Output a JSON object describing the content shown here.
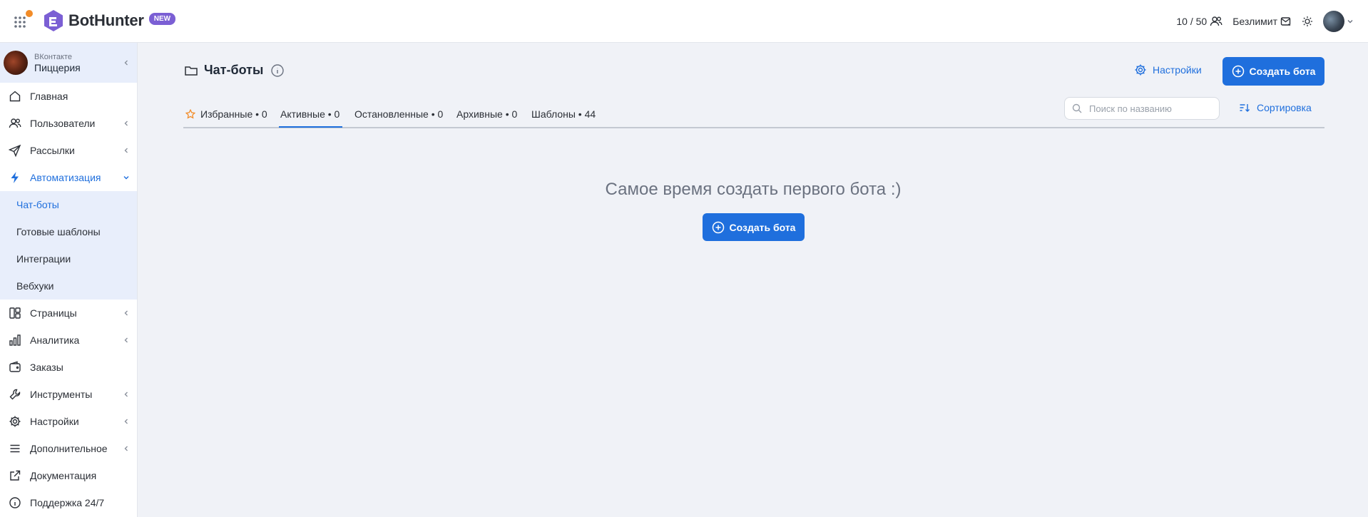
{
  "header": {
    "logo_text": "BotHunter",
    "new_badge": "NEW",
    "counter": "10 / 50",
    "plan": "Безлимит"
  },
  "sidebar": {
    "account": {
      "platform": "ВКонтакте",
      "name": "Пиццерия"
    },
    "items": [
      {
        "label": "Главная",
        "icon": "home-icon"
      },
      {
        "label": "Пользователи",
        "icon": "users-icon"
      },
      {
        "label": "Рассылки",
        "icon": "send-icon"
      },
      {
        "label": "Автоматизация",
        "icon": "lightning-icon"
      },
      {
        "label": "Страницы",
        "icon": "layout-icon"
      },
      {
        "label": "Аналитика",
        "icon": "bar-chart-icon"
      },
      {
        "label": "Заказы",
        "icon": "wallet-icon"
      },
      {
        "label": "Инструменты",
        "icon": "wrench-icon"
      },
      {
        "label": "Настройки",
        "icon": "gear-icon"
      },
      {
        "label": "Дополнительное",
        "icon": "menu-icon"
      },
      {
        "label": "Документация",
        "icon": "external-link-icon"
      },
      {
        "label": "Поддержка 24/7",
        "icon": "info-icon"
      }
    ],
    "automation_sub": [
      "Чат-боты",
      "Готовые шаблоны",
      "Интеграции",
      "Вебхуки"
    ]
  },
  "main": {
    "title": "Чат-боты",
    "settings_label": "Настройки",
    "create_label": "Создать бота",
    "tabs": [
      {
        "label": "Избранные • 0"
      },
      {
        "label": "Активные • 0"
      },
      {
        "label": "Остановленные • 0"
      },
      {
        "label": "Архивные • 0"
      },
      {
        "label": "Шаблоны • 44"
      }
    ],
    "search_placeholder": "Поиск по названию",
    "sort_label": "Сортировка",
    "empty_message": "Самое время создать первого бота :)"
  },
  "colors": {
    "accent": "#1f6fdd",
    "brand_purple": "#7b5fd4",
    "background": "#f0f2f7",
    "sidebar_highlight": "#e8eefb"
  }
}
